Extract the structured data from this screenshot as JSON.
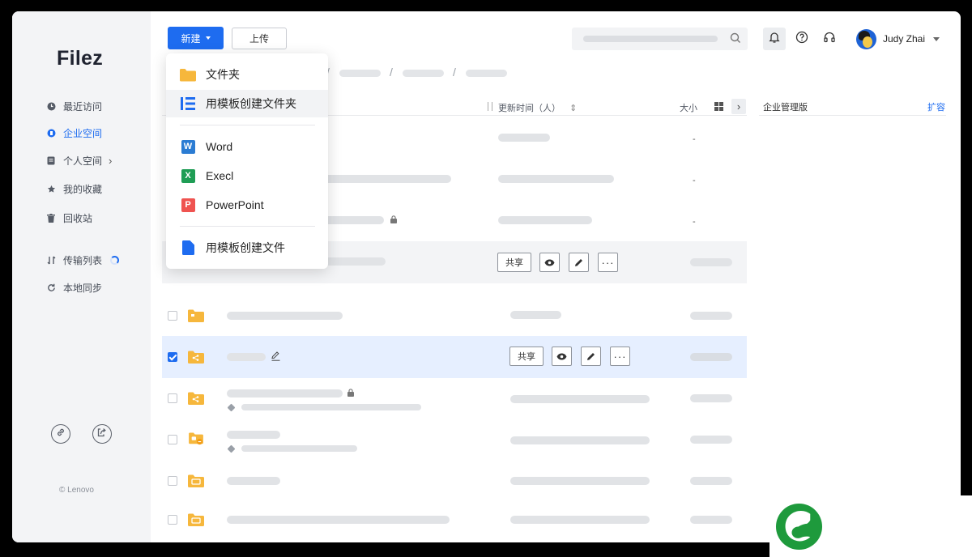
{
  "app": {
    "logo": "Filez",
    "copyright": "© Lenovo"
  },
  "sidebar": {
    "items": [
      {
        "label": "最近访问",
        "icon": "clock-icon"
      },
      {
        "label": "企业空间",
        "icon": "enterprise-icon",
        "active": true
      },
      {
        "label": "个人空间",
        "icon": "personal-icon",
        "has_arrow": true,
        "arrow": "›"
      },
      {
        "label": "我的收藏",
        "icon": "star-icon"
      },
      {
        "label": "回收站",
        "icon": "trash-icon"
      },
      {
        "label": "传输列表",
        "icon": "transfer-icon",
        "has_progress": true
      },
      {
        "label": "本地同步",
        "icon": "sync-icon"
      }
    ]
  },
  "toolbar": {
    "new_label": "新建",
    "upload_label": "上传"
  },
  "user": {
    "name": "Judy Zhai"
  },
  "table": {
    "col_updated": "更新时间（人）",
    "sort_glyph": "⇕",
    "col_size": "大小",
    "toggle_glyph": "›",
    "dash": "-"
  },
  "action_labels": {
    "share": "共享"
  },
  "side_panel": {
    "title": "企业管理版",
    "link": "扩容"
  },
  "dropdown": {
    "folder": "文件夹",
    "template_folder": "用模板创建文件夹",
    "word": "Word",
    "excel": "Execl",
    "powerpoint": "PowerPoint",
    "template_file": "用模板创建文件",
    "word_badge": "W",
    "excel_badge": "X",
    "ppt_badge": "P"
  },
  "colors": {
    "accent": "#1e6cf0",
    "folder": "#f6b73c",
    "word": "#2b7cd3",
    "excel": "#1f9d55",
    "powerpoint": "#ef5350",
    "brand_green": "#1e9a3c"
  }
}
